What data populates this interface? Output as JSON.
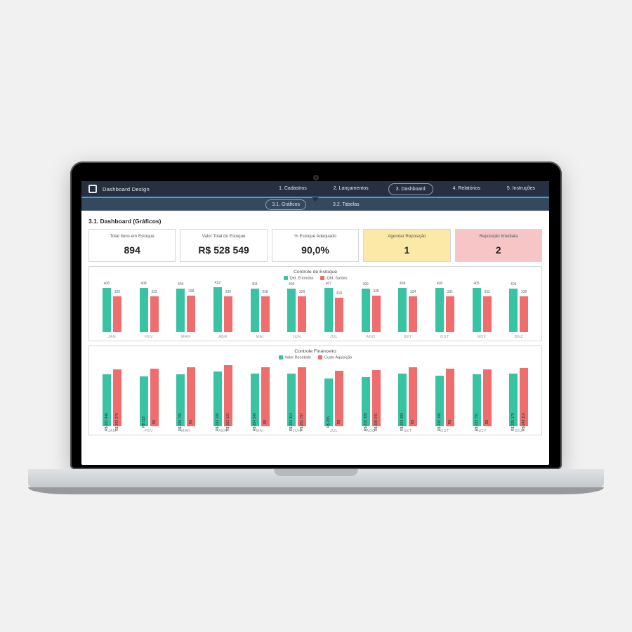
{
  "app": {
    "brand": "Dashboard Design"
  },
  "nav": {
    "top": [
      {
        "label": "1. Cadastros",
        "active": false
      },
      {
        "label": "2. Lançamentos",
        "active": false
      },
      {
        "label": "3. Dashboard",
        "active": true
      },
      {
        "label": "4. Relatórios",
        "active": false
      },
      {
        "label": "5. Instruções",
        "active": false
      }
    ],
    "sub": [
      {
        "label": "3.1. Gráficos",
        "active": true
      },
      {
        "label": "3.2. Tabelas",
        "active": false
      }
    ]
  },
  "page_title": "3.1. Dashboard (Gráficos)",
  "cards": [
    {
      "label": "Total Itens em Estoque",
      "value": "894",
      "tone": "plain"
    },
    {
      "label": "Valor Total do Estoque",
      "value": "R$ 528 549",
      "tone": "plain"
    },
    {
      "label": "% Estoque Adequado",
      "value": "90,0%",
      "tone": "plain"
    },
    {
      "label": "Agendar Reposição",
      "value": "1",
      "tone": "warn"
    },
    {
      "label": "Reposição Imediata",
      "value": "2",
      "tone": "danger"
    }
  ],
  "chart_data": [
    {
      "type": "bar",
      "title": "Controle de Estoque",
      "categories": [
        "JAN",
        "FEV",
        "MAR",
        "ABR",
        "MAI",
        "JUN",
        "JUL",
        "AGO",
        "SET",
        "OUT",
        "NOV",
        "DEZ"
      ],
      "ylim": [
        0,
        450
      ],
      "series": [
        {
          "name": "Qtd. Entradas",
          "color": "#38c3a3",
          "values": [
            408,
            408,
            404,
            412,
            404,
            400,
            407,
            399,
            408,
            408,
            405,
            404
          ]
        },
        {
          "name": "Qtd. Saídas",
          "color": "#ef6d6d",
          "values": [
            329,
            332,
            338,
            330,
            328,
            329,
            318,
            335,
            334,
            331,
            333,
            330
          ]
        }
      ]
    },
    {
      "type": "bar",
      "title": "Controle Financeiro",
      "categories": [
        "JAN",
        "FEV",
        "MAR",
        "ABR",
        "MAI",
        "JUN",
        "JUL",
        "AGO",
        "SET",
        "OUT",
        "NOV",
        "DEZ"
      ],
      "ylim": [
        0,
        270000
      ],
      "series": [
        {
          "name": "Valor Recebido",
          "color": "#38c3a3",
          "values": [
            221946,
            212500,
            220765,
            233106,
            224549,
            224314,
            205000,
            210328,
            223483,
            216190,
            222791,
            225179
          ],
          "labels": [
            "R$ 221 946",
            "R$ 212",
            "R$ 220 765",
            "R$ 233 106",
            "R$ 224 549",
            "R$ 224 314",
            "R$ 205",
            "R$ 210 328",
            "R$ 223 483",
            "R$ 216 190",
            "R$ 222 791",
            "R$ 225 179"
          ]
        },
        {
          "name": "Custo Aquisição",
          "color": "#ef6d6d",
          "values": [
            242276,
            245000,
            253000,
            262121,
            252400,
            251797,
            236000,
            239041,
            252500,
            246000,
            243000,
            248110
          ],
          "labels": [
            "R$ 242 276",
            "R$",
            "R$",
            "R$ 262 121",
            "R$",
            "R$ 251 797",
            "R$",
            "R$ 239 041",
            "R$",
            "R$",
            "R$",
            "R$ 248 110"
          ]
        }
      ]
    }
  ]
}
